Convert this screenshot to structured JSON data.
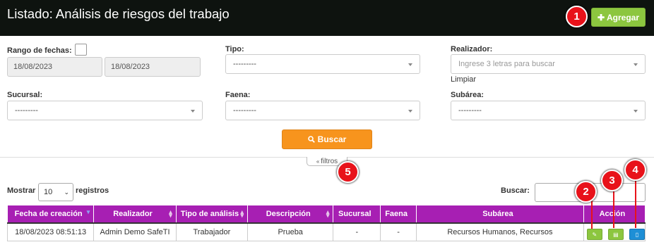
{
  "header": {
    "title": "Listado: Análisis de riesgos del trabajo",
    "add_label": "Agregar"
  },
  "filters": {
    "date_range_label": "Rango de fechas:",
    "date_from": "18/08/2023",
    "date_to": "18/08/2023",
    "tipo_label": "Tipo:",
    "tipo_value": "---------",
    "realizador_label": "Realizador:",
    "realizador_placeholder": "Ingrese 3 letras para buscar",
    "limpiar": "Limpiar",
    "sucursal_label": "Sucursal:",
    "sucursal_value": "---------",
    "faena_label": "Faena:",
    "faena_value": "---------",
    "subarea_label": "Subárea:",
    "subarea_value": "---------",
    "search_button": "Buscar",
    "toggle_label": "filtros"
  },
  "table_controls": {
    "show_label": "Mostrar",
    "page_length": "10",
    "records_label": "registros",
    "search_label": "Buscar:"
  },
  "table": {
    "headers": [
      "Fecha de creación",
      "Realizador",
      "Tipo de análisis",
      "Descripción",
      "Sucursal",
      "Faena",
      "Subárea",
      "Acción"
    ],
    "rows": [
      [
        "18/08/2023 08:51:13",
        "Admin Demo SafeTI",
        "Trabajador",
        "Prueba",
        "-",
        "-",
        "Recursos Humanos, Recursos"
      ]
    ]
  },
  "annotations": [
    "1",
    "2",
    "3",
    "4",
    "5"
  ],
  "colors": {
    "header_bg": "#0e130f",
    "accent_green": "#8cc63f",
    "accent_orange": "#f7941d",
    "table_header": "#a71fb3",
    "pdf_blue": "#1e8fd6",
    "badge_red": "#e8121a"
  },
  "icons": {
    "add": "plus-icon",
    "search": "magnifier-icon",
    "toggle": "double-chevron-up-icon",
    "edit": "pencil-icon",
    "view": "list-icon",
    "pdf": "document-icon"
  }
}
